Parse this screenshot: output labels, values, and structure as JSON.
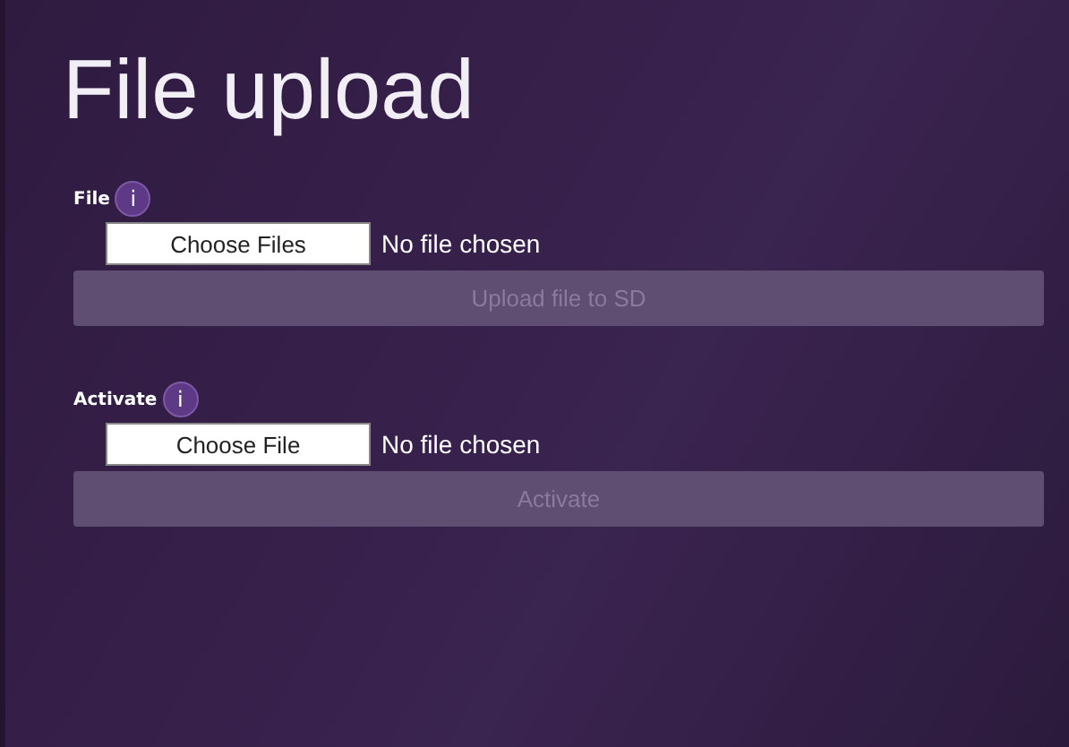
{
  "title": "File upload",
  "sections": [
    {
      "label": "File",
      "info": "i",
      "chooser": "Choose Files",
      "status": "No file chosen",
      "action": {
        "label": "Upload file to SD",
        "disabled": true
      }
    },
    {
      "label": "Activate",
      "info": "i",
      "chooser": "Choose File",
      "status": "No file chosen",
      "action": {
        "label": "Activate",
        "disabled": true
      }
    }
  ]
}
